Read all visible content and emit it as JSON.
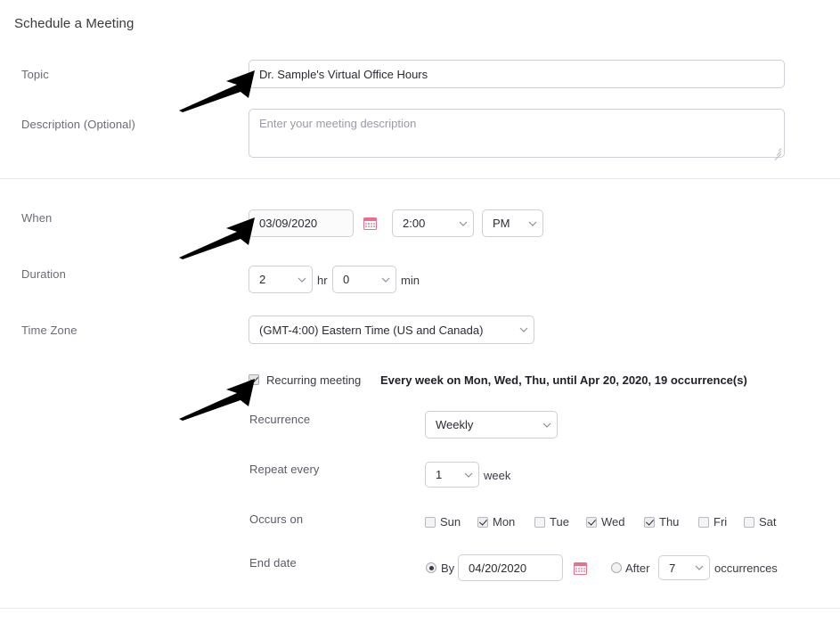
{
  "page": {
    "title": "Schedule a Meeting"
  },
  "topic": {
    "label": "Topic",
    "value": "Dr. Sample's Virtual Office Hours"
  },
  "description": {
    "label": "Description (Optional)",
    "placeholder": "Enter your meeting description",
    "value": ""
  },
  "when": {
    "label": "When",
    "date": "03/09/2020",
    "time": "2:00",
    "ampm": "PM",
    "calendar_icon": "calendar-icon"
  },
  "duration": {
    "label": "Duration",
    "hours": "2",
    "hours_unit": "hr",
    "minutes": "0",
    "minutes_unit": "min"
  },
  "timezone": {
    "label": "Time Zone",
    "value": "(GMT-4:00) Eastern Time (US and Canada)"
  },
  "recurring": {
    "checkbox_label": "Recurring meeting",
    "checked": true,
    "summary": "Every week on Mon, Wed, Thu, until Apr 20, 2020, 19 occurrence(s)",
    "recurrence": {
      "label": "Recurrence",
      "value": "Weekly"
    },
    "repeat_every": {
      "label": "Repeat every",
      "value": "1",
      "unit": "week"
    },
    "occurs_on": {
      "label": "Occurs on",
      "days": [
        {
          "name": "Sun",
          "checked": false
        },
        {
          "name": "Mon",
          "checked": true
        },
        {
          "name": "Tue",
          "checked": false
        },
        {
          "name": "Wed",
          "checked": true
        },
        {
          "name": "Thu",
          "checked": true
        },
        {
          "name": "Fri",
          "checked": false
        },
        {
          "name": "Sat",
          "checked": false
        }
      ]
    },
    "end_date": {
      "label": "End date",
      "by_label": "By",
      "by_selected": true,
      "by_date": "04/20/2020",
      "calendar_icon": "calendar-icon",
      "after_label": "After",
      "after_selected": false,
      "after_count": "7",
      "after_unit": "occurrences"
    }
  },
  "annotations": {
    "arrows": [
      {
        "name": "arrow-to-topic-field"
      },
      {
        "name": "arrow-to-when-date-field"
      },
      {
        "name": "arrow-to-recurring-checkbox"
      }
    ],
    "color": "#000000"
  },
  "colors": {
    "border": "#cfcfd6",
    "label": "#6b6b76",
    "text": "#2b2b33",
    "divider": "#e9e9ec",
    "calendar_icon": "#e8708a"
  }
}
